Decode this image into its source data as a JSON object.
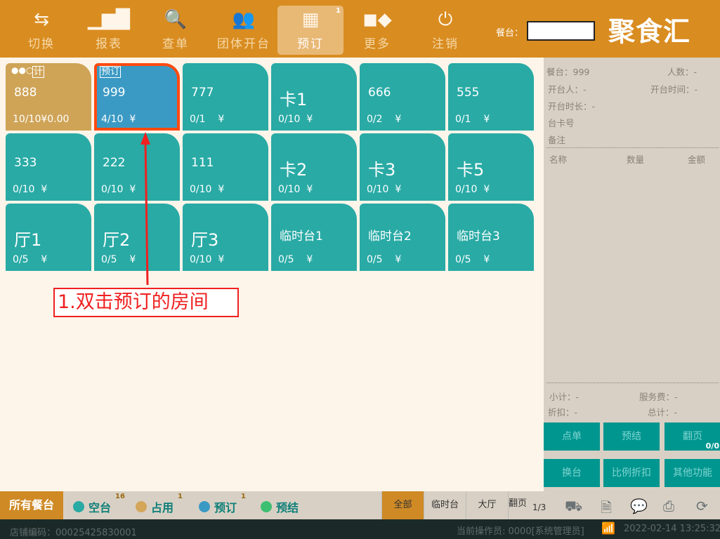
{
  "header": {
    "nav": [
      {
        "label": "切换",
        "icon": "swap-arrows-icon"
      },
      {
        "label": "报表",
        "icon": "bar-chart-icon"
      },
      {
        "label": "查单",
        "icon": "search-order-icon"
      },
      {
        "label": "团体开台",
        "icon": "group-icon"
      },
      {
        "label": "预订",
        "icon": "phone-icon",
        "badge": "1",
        "active": true
      },
      {
        "label": "更多",
        "icon": "grid-more-icon"
      },
      {
        "label": "注销",
        "icon": "power-icon"
      }
    ],
    "table_label": "餐台：",
    "table_input": "",
    "logo": "聚食汇"
  },
  "tables": [
    {
      "name": "888",
      "status": "10/10¥0.00",
      "state": "occupied",
      "tag": "计",
      "dots": "●●○"
    },
    {
      "name": "999",
      "status": "4/10  ¥",
      "state": "reserved",
      "tag": "预订"
    },
    {
      "name": "777",
      "status": "0/1    ¥",
      "state": "free"
    },
    {
      "name": "卡1",
      "status": "0/10  ¥",
      "state": "free"
    },
    {
      "name": "666",
      "status": "0/2    ¥",
      "state": "free"
    },
    {
      "name": "555",
      "status": "0/1    ¥",
      "state": "free"
    },
    {
      "name": "333",
      "status": "0/10  ¥",
      "state": "free"
    },
    {
      "name": "222",
      "status": "0/10  ¥",
      "state": "free"
    },
    {
      "name": "111",
      "status": "0/10  ¥",
      "state": "free"
    },
    {
      "name": "卡2",
      "status": "0/10  ¥",
      "state": "free"
    },
    {
      "name": "卡3",
      "status": "0/10  ¥",
      "state": "free"
    },
    {
      "name": "卡5",
      "status": "0/10  ¥",
      "state": "free"
    },
    {
      "name": "厅1",
      "status": "0/5    ¥",
      "state": "free"
    },
    {
      "name": "厅2",
      "status": "0/5    ¥",
      "state": "free"
    },
    {
      "name": "厅3",
      "status": "0/10  ¥",
      "state": "free"
    },
    {
      "name": "临时台1",
      "status": "0/5    ¥",
      "state": "free"
    },
    {
      "name": "临时台2",
      "status": "0/5    ¥",
      "state": "free"
    },
    {
      "name": "临时台3",
      "status": "0/5    ¥",
      "state": "free"
    }
  ],
  "annotation": "1.双击预订的房间",
  "side": {
    "table": "餐台：999",
    "people": "人数：-",
    "opener": "开台人：-",
    "open_time": "开台时间：-",
    "duration": "开台时长：-",
    "card": "台卡号",
    "remark": "备注",
    "cols": [
      "名称",
      "数量",
      "金额"
    ],
    "subtotal": "小计：-",
    "service": "服务费：-",
    "discount": "折扣：-",
    "total": "总计：-",
    "buttons": [
      "点单",
      "预结",
      "翻页",
      "换台",
      "比例折扣",
      "其他功能"
    ],
    "page_badge": "0/0"
  },
  "bar": {
    "all": "所有餐台",
    "legend": [
      {
        "label": "空台",
        "count": "16",
        "color": "#29aaa5"
      },
      {
        "label": "占用",
        "count": "1",
        "color": "#d4a65a"
      },
      {
        "label": "预订",
        "count": "1",
        "color": "#3b9ac4"
      },
      {
        "label": "预结",
        "count": "",
        "color": "#3dbf72"
      }
    ],
    "filters": [
      "全部",
      "临时台",
      "大厅"
    ],
    "page_label": "翻页",
    "page": "1/3"
  },
  "footer": {
    "store": "店铺编码：00025425830001",
    "operator": "当前操作员:  0000[系统管理员]",
    "datetime": "2022-02-14 13:25:32"
  }
}
